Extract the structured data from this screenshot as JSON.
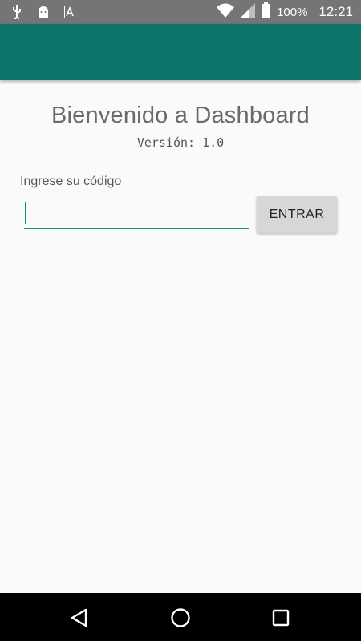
{
  "status_bar": {
    "battery_percent": "100%",
    "time": "12:21",
    "icons": [
      "usb-icon",
      "android-icon",
      "a-notification-icon",
      "wifi-icon",
      "signal-icon",
      "battery-icon"
    ]
  },
  "main": {
    "title": "Bienvenido a Dashboard",
    "version": "Versión: 1.0",
    "code_label": "Ingrese su código",
    "code_input_value": "",
    "enter_button": "ENTRAR"
  },
  "nav_bar": {
    "icons": [
      "back-icon",
      "home-icon",
      "recents-icon"
    ]
  },
  "colors": {
    "app_bar": "#0f7469",
    "accent": "#159184",
    "status_bar": "#757575"
  }
}
